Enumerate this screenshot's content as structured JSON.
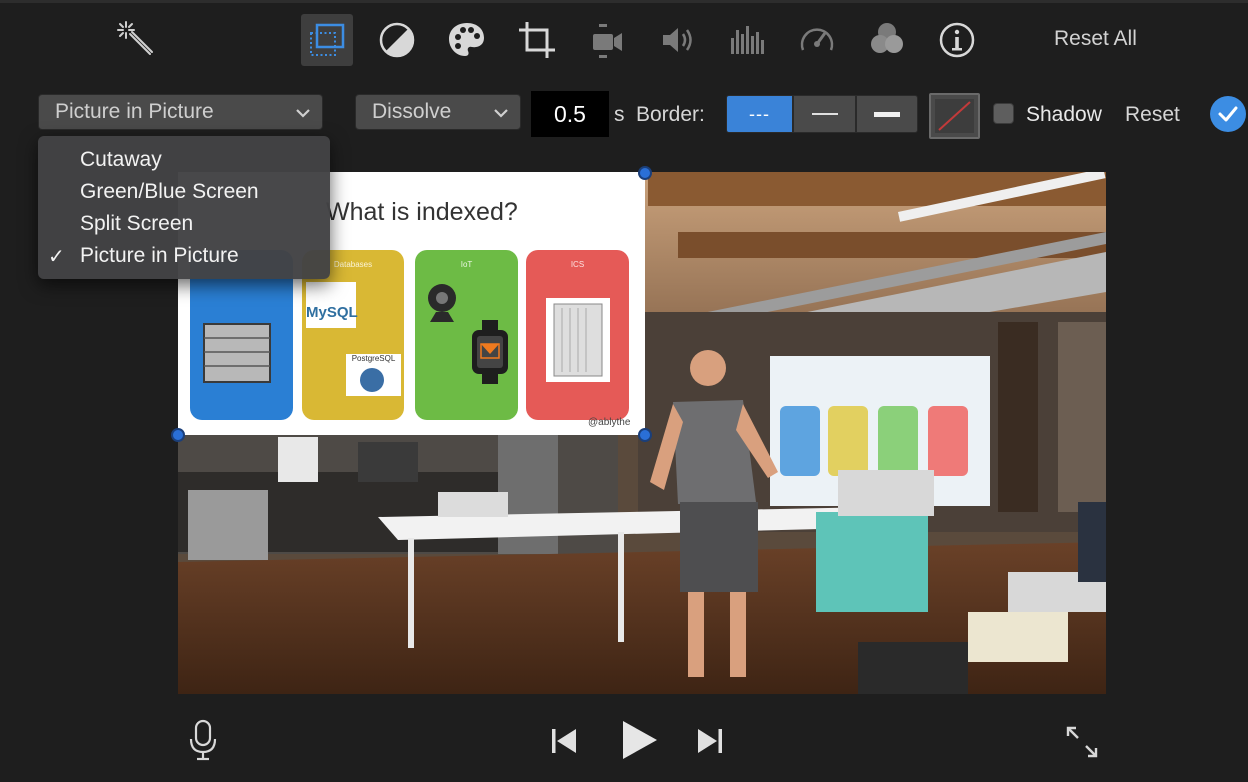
{
  "toolbar": {
    "icons": [
      "magic-wand-icon",
      "video-overlay-icon",
      "color-balance-icon",
      "color-palette-icon",
      "crop-icon",
      "stabilization-icon",
      "volume-icon",
      "noise-equalizer-icon",
      "speed-icon",
      "clip-filter-icon",
      "info-icon"
    ],
    "reset_all": "Reset All"
  },
  "overlay": {
    "style_value": "Picture in Picture",
    "transition_value": "Dissolve",
    "duration": "0.5",
    "duration_unit": "s",
    "border_label": "Border:",
    "border_options": [
      "---",
      "thin",
      "thick"
    ],
    "shadow_label": "Shadow",
    "reset_label": "Reset"
  },
  "menu": {
    "items": [
      "Cutaway",
      "Green/Blue Screen",
      "Split Screen",
      "Picture in Picture"
    ],
    "checked_index": 3,
    "check_mark": "✓"
  },
  "slide": {
    "title": "What is indexed?",
    "card_labels": [
      "",
      "Databases",
      "IoT",
      "ICS"
    ],
    "logos": [
      "MySQL",
      "PostgreSQL"
    ],
    "handle": "@ablythe"
  },
  "colors": {
    "accent": "#3a83d8",
    "card_blue": "#2a7fd4",
    "card_yellow": "#d9b834",
    "card_green": "#6dbb45",
    "card_red": "#e55a57"
  }
}
